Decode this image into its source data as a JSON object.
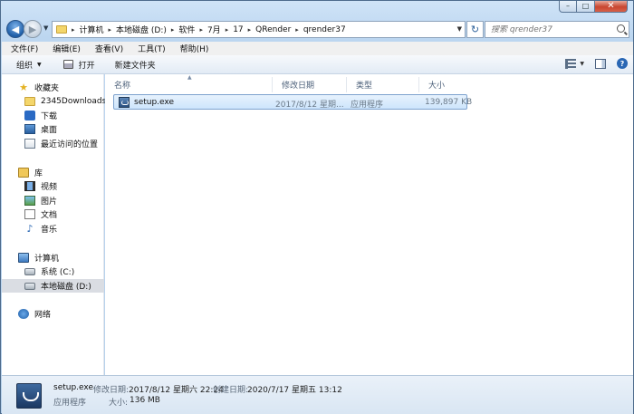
{
  "window": {
    "minimize_glyph": "–",
    "maximize_glyph": "□",
    "close_glyph": "✕"
  },
  "address": {
    "separator": "▸",
    "crumbs": [
      "计算机",
      "本地磁盘 (D:)",
      "软件",
      "7月",
      "17",
      "QRender",
      "qrender37"
    ],
    "search_placeholder": "搜索 qrender37"
  },
  "menu": [
    "文件(F)",
    "编辑(E)",
    "查看(V)",
    "工具(T)",
    "帮助(H)"
  ],
  "toolbar": {
    "organize": "组织",
    "print": "打开",
    "new_folder": "新建文件夹"
  },
  "sidebar": {
    "favorites": {
      "label": "收藏夹",
      "items": [
        "2345Downloads",
        "下载",
        "桌面",
        "最近访问的位置"
      ]
    },
    "libraries": {
      "label": "库",
      "items": [
        "视频",
        "图片",
        "文档",
        "音乐"
      ]
    },
    "computer": {
      "label": "计算机",
      "items": [
        "系统 (C:)",
        "本地磁盘 (D:)"
      ]
    },
    "network": {
      "label": "网络"
    }
  },
  "columns": [
    "名称",
    "修改日期",
    "类型",
    "大小"
  ],
  "files": [
    {
      "name": "setup.exe",
      "modified": "2017/8/12 星期...",
      "type": "应用程序",
      "size": "139,897 KB"
    }
  ],
  "details": {
    "name": "setup.exe",
    "modified_label": "修改日期:",
    "modified": "2017/8/12 星期六 22:24",
    "created_label": "创建日期:",
    "created": "2020/7/17 星期五 13:12",
    "type": "应用程序",
    "size_label": "大小:",
    "size": "136 MB"
  }
}
